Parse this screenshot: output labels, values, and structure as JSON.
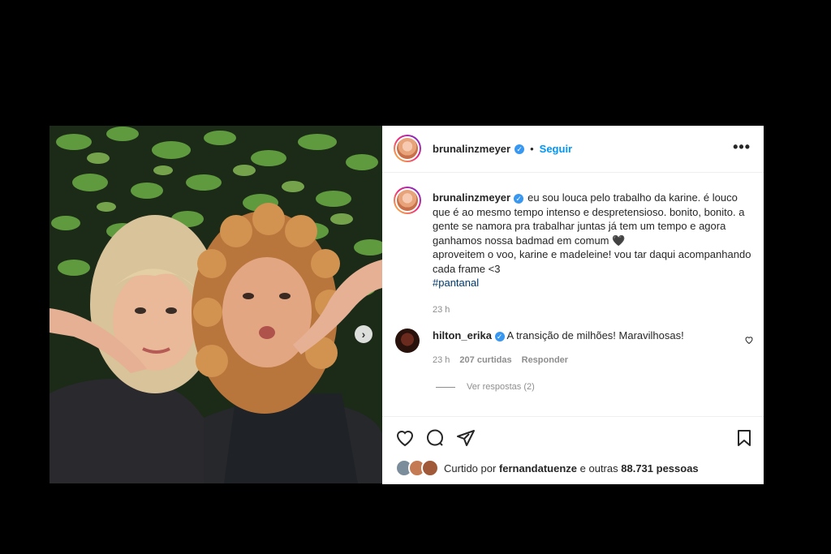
{
  "post": {
    "username": "brunalinzmeyer",
    "separator": "•",
    "follow_label": "Seguir",
    "more_label": "•••",
    "verified_mark": "✓",
    "next_label": "›"
  },
  "caption": {
    "username": "brunalinzmeyer",
    "text": "eu sou louca pelo trabalho da karine. é louco que é ao mesmo tempo intenso e despretensioso. bonito, bonito. a gente se namora pra trabalhar juntas já tem um tempo e agora ganhamos nossa badmad em comum 🖤",
    "text2": "aproveitem o voo, karine e madeleine! vou tar daqui acompanhando cada frame <3",
    "hashtag": "#pantanal",
    "time": "23 h"
  },
  "comment": {
    "username": "hilton_erika",
    "text": "A transição de milhões! Maravilhosas!",
    "time": "23 h",
    "likes": "207 curtidas",
    "reply_label": "Responder",
    "view_replies": "Ver respostas (2)"
  },
  "likes": {
    "prefix": "Curtido por",
    "user": "fernandatuenze",
    "suffix": "e outras",
    "count": "88.731 pessoas"
  },
  "icons": [
    "heart-icon",
    "comment-icon",
    "share-icon",
    "bookmark-icon",
    "more-icon",
    "verified-icon",
    "chevron-right-icon"
  ]
}
